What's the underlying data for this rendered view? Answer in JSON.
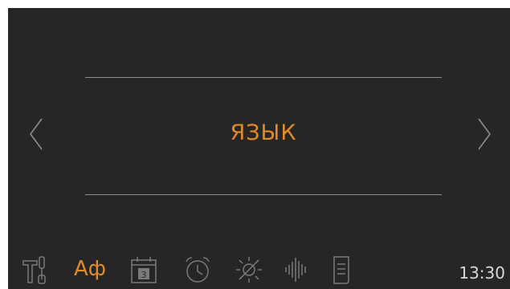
{
  "screen": {
    "title": "ЯЗЫК"
  },
  "tabbar": {
    "language_tab_label": "Аф",
    "calendar_day": "3",
    "time": "13:30"
  },
  "icons": [
    "tools-icon",
    "language-icon",
    "calendar-icon",
    "alarm-clock-icon",
    "brightness-icon",
    "sound-icon",
    "document-icon",
    "chevron-left-icon",
    "chevron-right-icon"
  ],
  "colors": {
    "background": "#262626",
    "accent": "#e08a2c",
    "inactive_icon": "#7a7a7a",
    "divider": "#8e8e8e",
    "time_text": "#d8d8d8"
  }
}
